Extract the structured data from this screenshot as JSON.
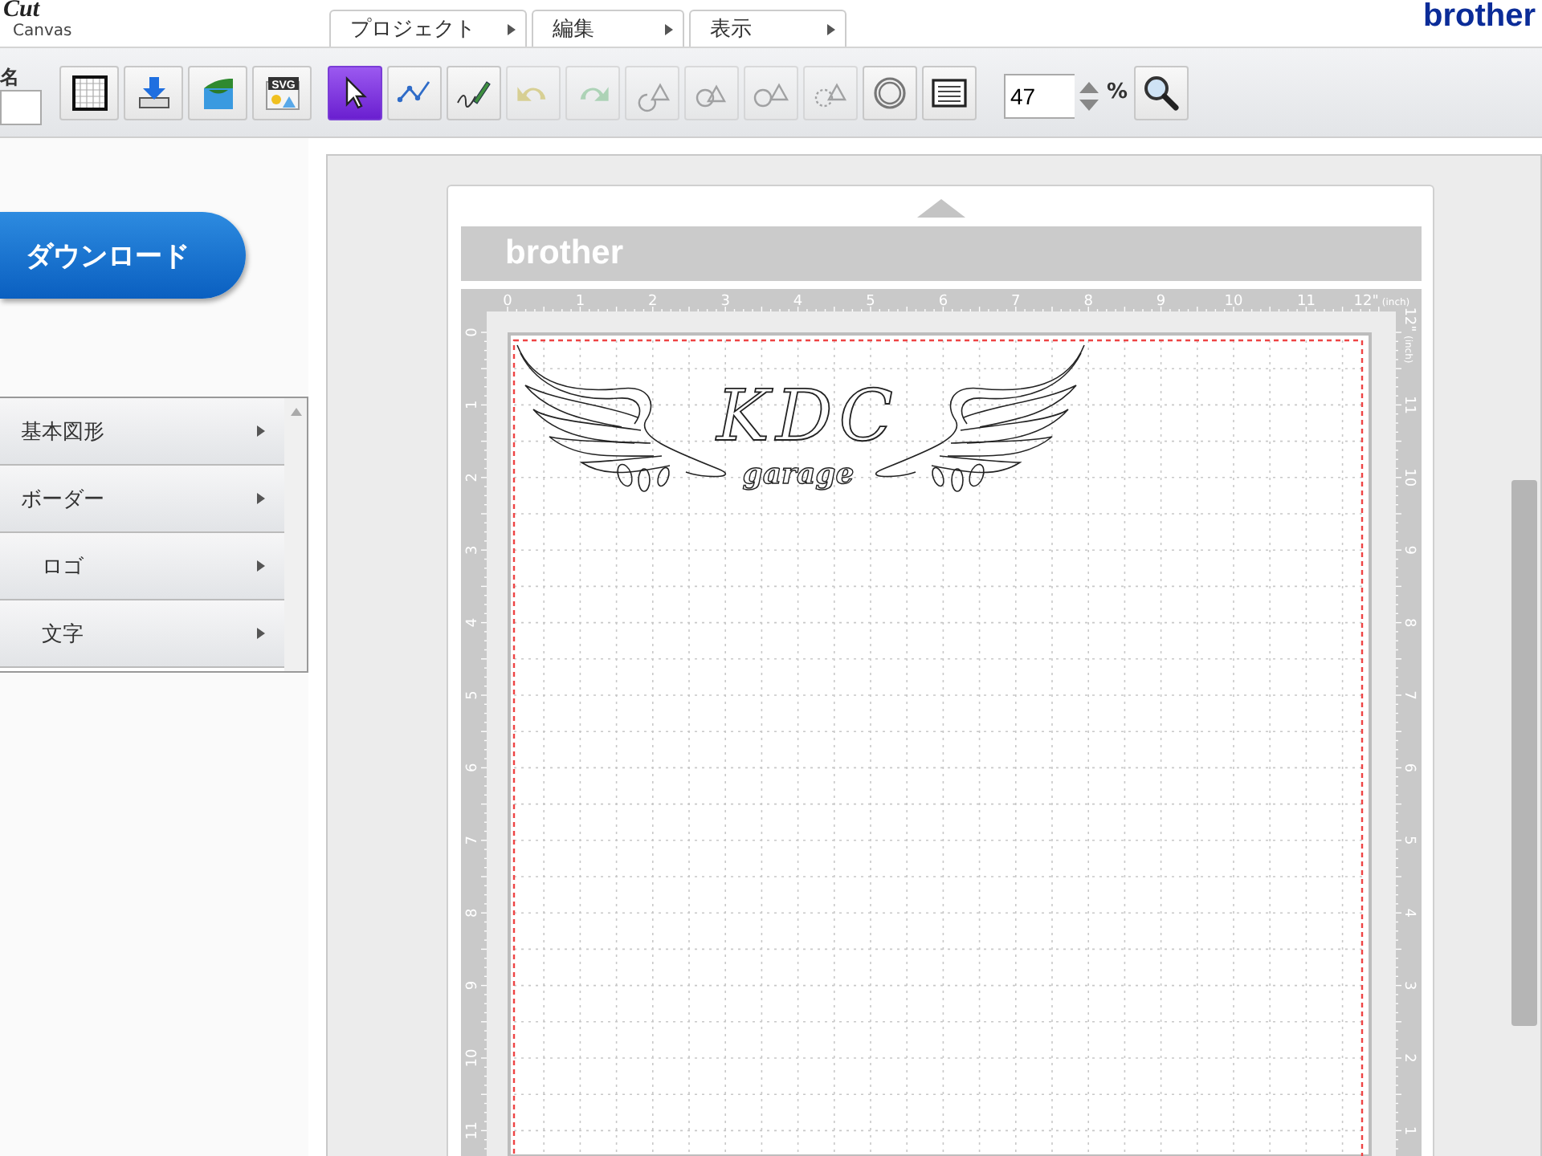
{
  "header": {
    "logo": {
      "word": "Cut",
      "sub": "Canvas"
    },
    "menus": [
      {
        "label": "プロジェクト"
      },
      {
        "label": "編集"
      },
      {
        "label": "表示"
      }
    ],
    "brand": "brother"
  },
  "toolbar": {
    "name_label": "名",
    "tools": [
      {
        "kind": "grid",
        "selected": false,
        "disabled": false
      },
      {
        "kind": "save",
        "selected": false,
        "disabled": false
      },
      {
        "kind": "image",
        "selected": false,
        "disabled": false
      },
      {
        "kind": "svg",
        "label": "SVG",
        "selected": false,
        "disabled": false
      },
      {
        "kind": "select",
        "selected": true,
        "disabled": false
      },
      {
        "kind": "nodes",
        "selected": false,
        "disabled": false
      },
      {
        "kind": "pencil",
        "selected": false,
        "disabled": false
      },
      {
        "kind": "undo",
        "selected": false,
        "disabled": true
      },
      {
        "kind": "redo",
        "selected": false,
        "disabled": true
      },
      {
        "kind": "weld",
        "selected": false,
        "disabled": true
      },
      {
        "kind": "intersect",
        "selected": false,
        "disabled": true
      },
      {
        "kind": "subtract",
        "selected": false,
        "disabled": true
      },
      {
        "kind": "exclude",
        "selected": false,
        "disabled": true
      },
      {
        "kind": "offset",
        "selected": false,
        "disabled": false
      },
      {
        "kind": "list",
        "selected": false,
        "disabled": false
      }
    ],
    "zoom": {
      "value": "47",
      "unit": "%"
    }
  },
  "sidebar": {
    "download": "ダウンロード",
    "categories": [
      {
        "label": "基本図形"
      },
      {
        "label": "ボーダー"
      },
      {
        "label": "ロゴ"
      },
      {
        "label": "文字"
      }
    ]
  },
  "mat": {
    "brand": "brother",
    "top_ruler": [
      "0",
      "1",
      "2",
      "3",
      "4",
      "5",
      "6",
      "7",
      "8",
      "9",
      "10",
      "11",
      "12\""
    ],
    "top_unit": "(inch)",
    "left_ruler": [
      "0",
      "1",
      "2",
      "3",
      "4",
      "5",
      "6",
      "7",
      "8",
      "9",
      "10",
      "11"
    ],
    "right_ruler": [
      "12\"",
      "11",
      "10",
      "9",
      "8",
      "7",
      "6",
      "5",
      "4",
      "3",
      "2",
      "1"
    ],
    "right_unit": "(inch)",
    "artwork": {
      "title": "KDC",
      "subtitle": "garage"
    }
  }
}
